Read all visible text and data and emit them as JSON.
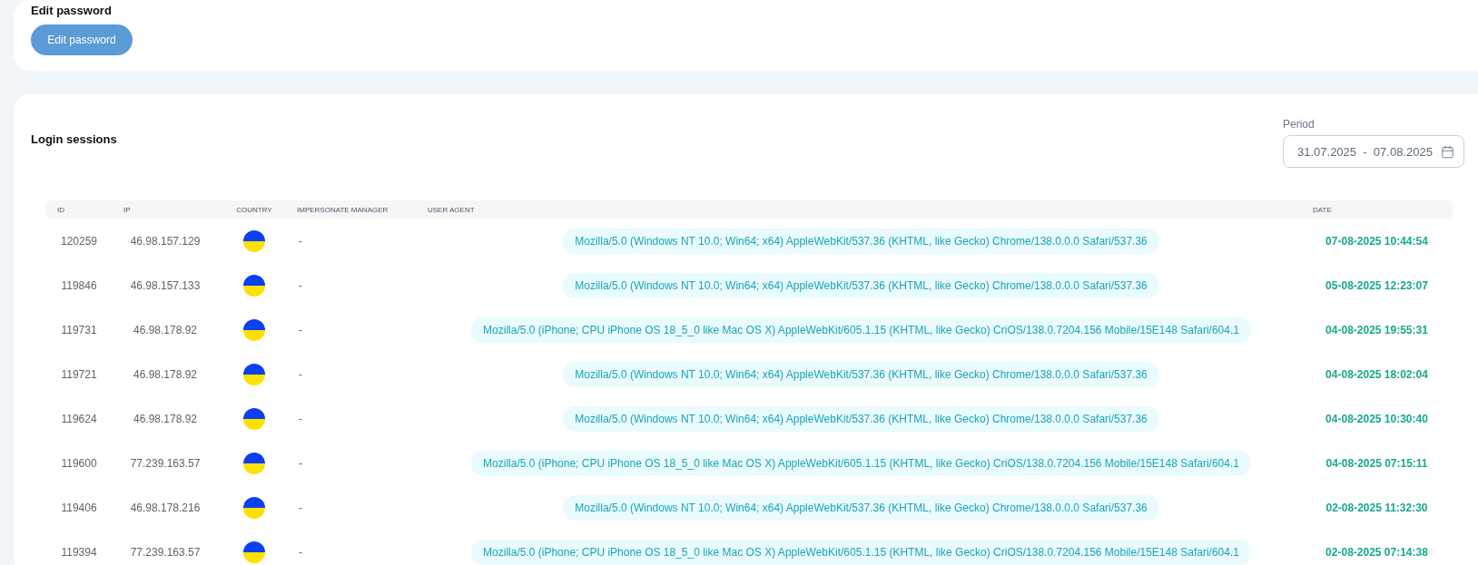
{
  "edit_password": {
    "title": "Edit password",
    "button": "Edit password"
  },
  "login_sessions": {
    "title": "Login sessions",
    "period": {
      "label": "Period",
      "value": "31.07.2025  -  07.08.2025"
    },
    "table": {
      "columns": [
        "ID",
        "IP",
        "COUNTRY",
        "IMPERSONATE MANAGER",
        "USER AGENT",
        "DATE"
      ],
      "rows": [
        {
          "id": "120259",
          "ip": "46.98.157.129",
          "impersonate_manager": "-",
          "user_agent": "Mozilla/5.0 (Windows NT 10.0; Win64; x64) AppleWebKit/537.36 (KHTML, like Gecko) Chrome/138.0.0.0 Safari/537.36",
          "date": "07-08-2025 10:44:54"
        },
        {
          "id": "119846",
          "ip": "46.98.157.133",
          "impersonate_manager": "-",
          "user_agent": "Mozilla/5.0 (Windows NT 10.0; Win64; x64) AppleWebKit/537.36 (KHTML, like Gecko) Chrome/138.0.0.0 Safari/537.36",
          "date": "05-08-2025 12:23:07"
        },
        {
          "id": "119731",
          "ip": "46.98.178.92",
          "impersonate_manager": "-",
          "user_agent": "Mozilla/5.0 (iPhone; CPU iPhone OS 18_5_0 like Mac OS X) AppleWebKit/605.1.15 (KHTML, like Gecko) CriOS/138.0.7204.156 Mobile/15E148 Safari/604.1",
          "date": "04-08-2025 19:55:31"
        },
        {
          "id": "119721",
          "ip": "46.98.178.92",
          "impersonate_manager": "-",
          "user_agent": "Mozilla/5.0 (Windows NT 10.0; Win64; x64) AppleWebKit/537.36 (KHTML, like Gecko) Chrome/138.0.0.0 Safari/537.36",
          "date": "04-08-2025 18:02:04"
        },
        {
          "id": "119624",
          "ip": "46.98.178.92",
          "impersonate_manager": "-",
          "user_agent": "Mozilla/5.0 (Windows NT 10.0; Win64; x64) AppleWebKit/537.36 (KHTML, like Gecko) Chrome/138.0.0.0 Safari/537.36",
          "date": "04-08-2025 10:30:40"
        },
        {
          "id": "119600",
          "ip": "77.239.163.57",
          "impersonate_manager": "-",
          "user_agent": "Mozilla/5.0 (iPhone; CPU iPhone OS 18_5_0 like Mac OS X) AppleWebKit/605.1.15 (KHTML, like Gecko) CriOS/138.0.7204.156 Mobile/15E148 Safari/604.1",
          "date": "04-08-2025 07:15:11"
        },
        {
          "id": "119406",
          "ip": "46.98.178.216",
          "impersonate_manager": "-",
          "user_agent": "Mozilla/5.0 (Windows NT 10.0; Win64; x64) AppleWebKit/537.36 (KHTML, like Gecko) Chrome/138.0.0.0 Safari/537.36",
          "date": "02-08-2025 11:32:30"
        },
        {
          "id": "119394",
          "ip": "77.239.163.57",
          "impersonate_manager": "-",
          "user_agent": "Mozilla/5.0 (iPhone; CPU iPhone OS 18_5_0 like Mac OS X) AppleWebKit/605.1.15 (KHTML, like Gecko) CriOS/138.0.7204.156 Mobile/15E148 Safari/604.1",
          "date": "02-08-2025 07:14:38"
        }
      ]
    }
  }
}
